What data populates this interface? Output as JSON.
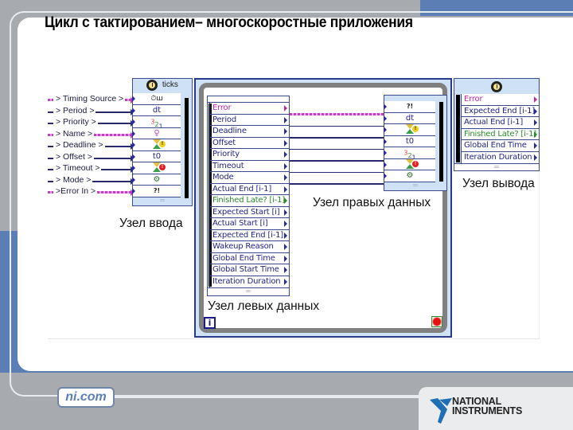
{
  "slide": {
    "title": "Цикл с тактированием– многоскоростные приложения"
  },
  "inputs": [
    {
      "label": "> Timing Source >",
      "pink": true
    },
    {
      "label": "> Period >",
      "pink": false
    },
    {
      "label": "> Priority >",
      "pink": false
    },
    {
      "label": "> Name >",
      "pink": true
    },
    {
      "label": "> Deadline >",
      "pink": false
    },
    {
      "label": "> Offset >",
      "pink": false
    },
    {
      "label": "> Timeout >",
      "pink": false
    },
    {
      "label": "> Mode >",
      "pink": false
    },
    {
      "label": ">Error In >",
      "pink": true
    }
  ],
  "input_node": {
    "header_label": "ticks",
    "cells": [
      {
        "icon": "timing-source-icon",
        "text": "⏱ш"
      },
      {
        "icon": "dt-label",
        "text": "dt"
      },
      {
        "icon": "priority-icon",
        "text": ""
      },
      {
        "icon": "name-icon",
        "text": "♀"
      },
      {
        "icon": "deadline-hourglass-icon",
        "text": ""
      },
      {
        "icon": "t0-label",
        "text": "t0"
      },
      {
        "icon": "timeout-hourglass-icon",
        "text": ""
      },
      {
        "icon": "mode-icon",
        "text": "⚙"
      },
      {
        "icon": "error-in-icon",
        "text": "?!"
      }
    ],
    "caption": "Узел ввода"
  },
  "left_data_node": {
    "rows": [
      {
        "label": "Error",
        "style": "pink"
      },
      {
        "label": "Period",
        "style": ""
      },
      {
        "label": "Deadline",
        "style": ""
      },
      {
        "label": "Offset",
        "style": ""
      },
      {
        "label": "Priority",
        "style": ""
      },
      {
        "label": "Timeout",
        "style": ""
      },
      {
        "label": "Mode",
        "style": ""
      },
      {
        "label": "Actual End [i-1]",
        "style": ""
      },
      {
        "label": "Finished Late? [i-1]",
        "style": "green"
      },
      {
        "label": "Expected Start [i]",
        "style": ""
      },
      {
        "label": "Actual Start [i]",
        "style": ""
      },
      {
        "label": "Expected End [i-1]",
        "style": ""
      },
      {
        "label": "Wakeup Reason",
        "style": ""
      },
      {
        "label": "Global End Time",
        "style": ""
      },
      {
        "label": "Global Start Time",
        "style": ""
      },
      {
        "label": "Iteration Duration",
        "style": ""
      }
    ],
    "caption": "Узел левых данных"
  },
  "right_data_node": {
    "cells": [
      {
        "icon": "error-icon",
        "text": "?!"
      },
      {
        "icon": "dt-label",
        "text": "dt"
      },
      {
        "icon": "deadline-hourglass-icon",
        "text": ""
      },
      {
        "icon": "t0-label",
        "text": "t0"
      },
      {
        "icon": "priority-icon",
        "text": ""
      },
      {
        "icon": "timeout-hourglass-icon",
        "text": ""
      },
      {
        "icon": "mode-icon",
        "text": "⚙"
      }
    ],
    "caption": "Узел правых данных"
  },
  "output_node": {
    "rows": [
      {
        "label": "Error",
        "style": "pink"
      },
      {
        "label": "Expected End [i-1]",
        "style": ""
      },
      {
        "label": "Actual End [i-1]",
        "style": ""
      },
      {
        "label": "Finished Late? [i-1]",
        "style": "green"
      },
      {
        "label": "Global End Time",
        "style": ""
      },
      {
        "label": "Iteration Duration",
        "style": ""
      }
    ],
    "caption": "Узел вывода"
  },
  "loop": {
    "iteration_label": "i"
  },
  "footer": {
    "site_label": "ni.com",
    "logo_line1": "NATIONAL",
    "logo_line2": "INSTRUMENTS",
    "brand_blue": "#5b7fb5",
    "band_gray": "#a7abaf"
  }
}
